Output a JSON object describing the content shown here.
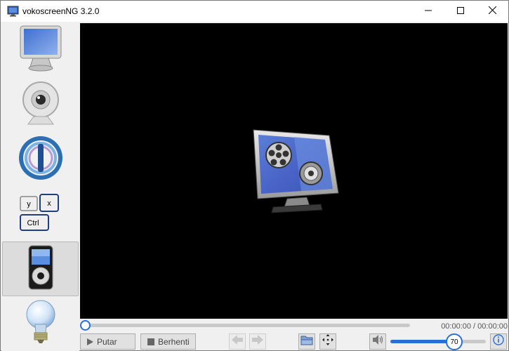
{
  "window": {
    "title": "vokoscreenNG 3.2.0",
    "icons": {
      "app": "vokoscreen-app-icon",
      "minimize": "minimize-icon",
      "maximize": "maximize-icon",
      "close": "close-icon"
    }
  },
  "sidebar": {
    "items": [
      {
        "id": "screencast",
        "icon": "monitor-icon",
        "active": false
      },
      {
        "id": "camera",
        "icon": "webcam-icon",
        "active": false
      },
      {
        "id": "system",
        "icon": "power-circle-icon",
        "active": false
      },
      {
        "id": "shortcuts",
        "icon": "keyboard-keys-icon",
        "keys": [
          "y",
          "x",
          "Ctrl"
        ],
        "active": false
      },
      {
        "id": "player",
        "icon": "media-player-icon",
        "active": true
      },
      {
        "id": "about",
        "icon": "lightbulb-icon",
        "active": false
      }
    ]
  },
  "player": {
    "video_icon": "film-speaker-monitor-icon",
    "time": "00:00:00 / 00:00:00",
    "progress": 0,
    "play_label": "Putar",
    "stop_label": "Berhenti",
    "volume": "70",
    "volume_fraction": 0.7,
    "buttons": {
      "back": "arrow-left-icon",
      "forward": "arrow-right-icon",
      "open": "folder-icon",
      "move": "move-arrows-icon",
      "mute": "speaker-icon",
      "info": "info-icon"
    }
  },
  "colors": {
    "accent": "#2a6fd6",
    "video_bg": "#000000"
  }
}
